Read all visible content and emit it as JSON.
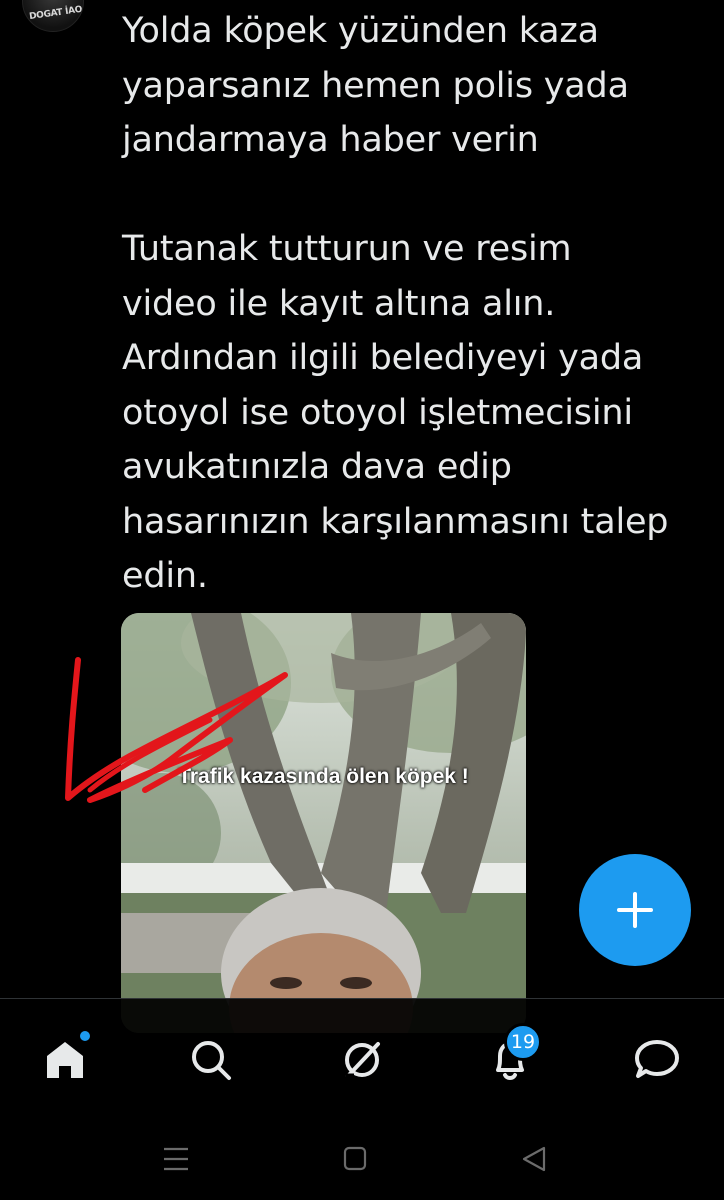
{
  "header": {
    "avatar_label": "DOGAT İAO..."
  },
  "tweet": {
    "text": "Yolda köpek yüzünden kaza\nyaparsanız hemen polis yada\njandarmaya haber verin\n\nTutanak tutturun ve resim\nvideo ile kayıt altına alın.\nArdından ilgili belediyeyi yada\notoyol ise otoyol işletmecisini\navukatınızla dava edip\nhasarınızın karşılanmasını talep\nedin."
  },
  "media": {
    "caption": "Trafik kazasında ölen köpek !"
  },
  "fab": {
    "icon": "plus-icon"
  },
  "bottom_nav": {
    "items": [
      {
        "name": "home",
        "icon": "home-icon",
        "active": true
      },
      {
        "name": "search",
        "icon": "search-icon"
      },
      {
        "name": "grok",
        "icon": "grok-icon"
      },
      {
        "name": "notifications",
        "icon": "bell-icon",
        "badge": "19"
      },
      {
        "name": "messages",
        "icon": "message-icon"
      }
    ]
  },
  "system_nav": {
    "items": [
      "recents-icon",
      "home-square-icon",
      "back-triangle-icon"
    ]
  },
  "colors": {
    "accent": "#1d9bf0",
    "background": "#000000",
    "text": "#e7e9ea",
    "annotation": "#e3161b"
  }
}
